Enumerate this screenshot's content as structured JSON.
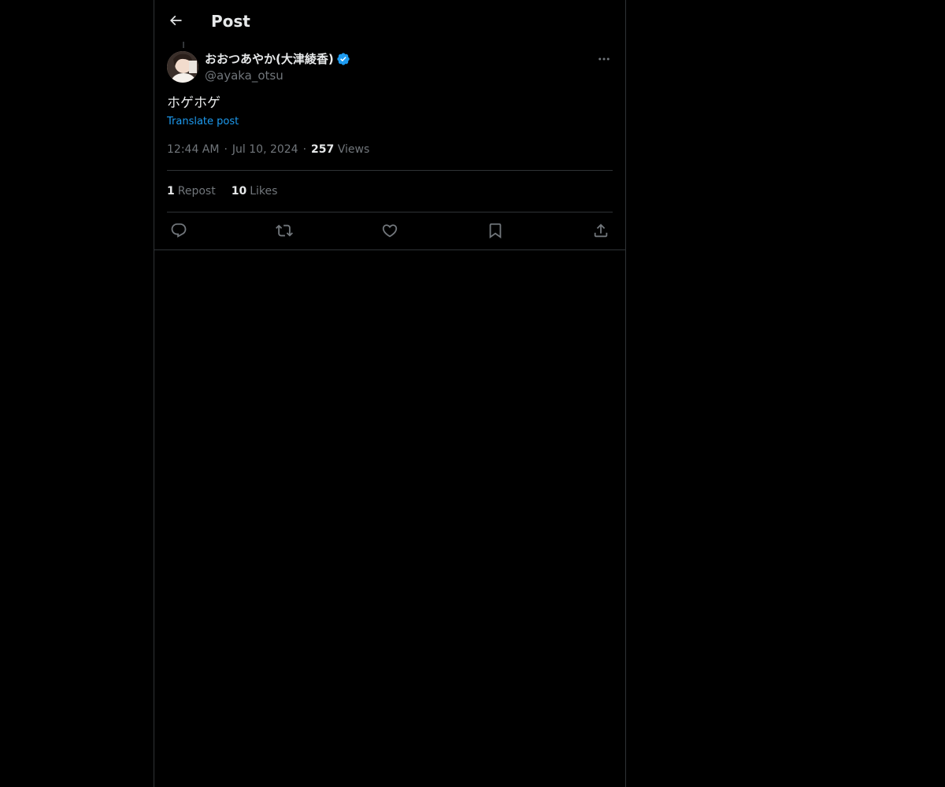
{
  "header": {
    "title": "Post",
    "back_icon": "arrow-left-icon"
  },
  "post": {
    "author": {
      "display_name": "おおつあやか(大津綾香)",
      "handle": "@ayaka_otsu",
      "verified": true,
      "verified_color": "#1d9bf0"
    },
    "text": "ホゲホゲ",
    "translate_label": "Translate post",
    "time": "12:44 AM",
    "date": "Jul 10, 2024",
    "separator": "·",
    "views_count": "257",
    "views_label": "Views",
    "reposts_count": "1",
    "reposts_label": "Repost",
    "likes_count": "10",
    "likes_label": "Likes"
  },
  "actions": [
    {
      "icon": "reply-icon"
    },
    {
      "icon": "repost-icon"
    },
    {
      "icon": "like-icon"
    },
    {
      "icon": "bookmark-icon"
    },
    {
      "icon": "share-icon"
    }
  ],
  "colors": {
    "background": "#000000",
    "text_primary": "#e7e9ea",
    "text_secondary": "#71767b",
    "link": "#1d9bf0",
    "border": "#2f3336"
  }
}
